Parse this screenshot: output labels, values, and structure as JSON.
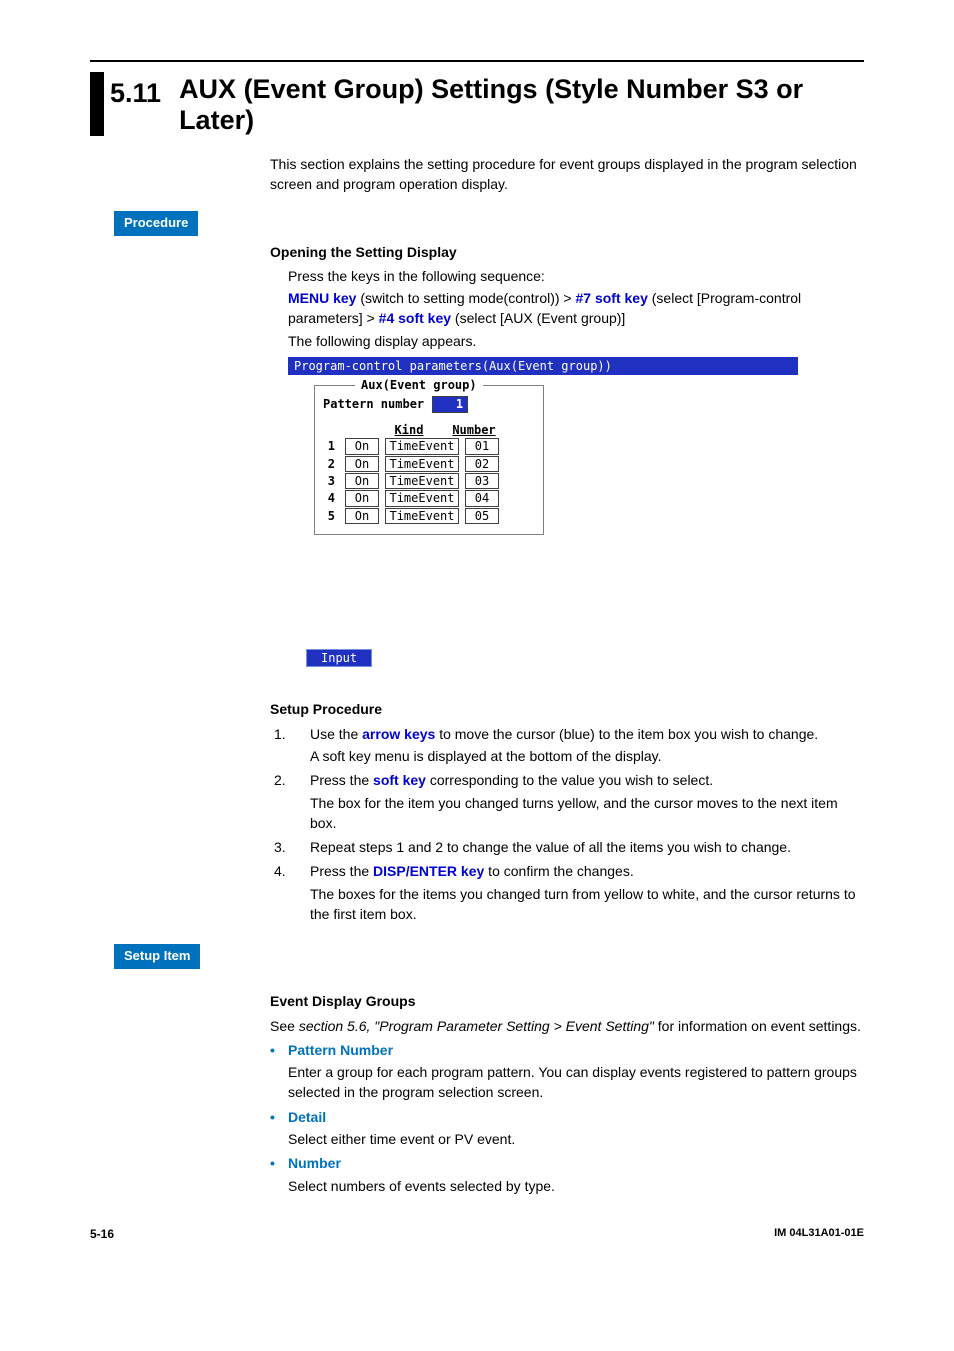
{
  "section": {
    "number": "5.11",
    "title": "AUX (Event Group) Settings (Style Number S3 or Later)"
  },
  "intro": "This section explains the setting procedure for event groups displayed in the program selection screen and program operation display.",
  "tags": {
    "procedure": "Procedure",
    "setup_item": "Setup Item"
  },
  "opening": {
    "heading": "Opening the Setting Display",
    "press": "Press the keys in the following sequence:",
    "seq": {
      "menu_key": "MENU key",
      "t1": " (switch to setting mode(control)) > ",
      "soft7": "#7 soft key",
      "t2": " (select [Program-control parameters] > ",
      "soft4": "#4 soft key",
      "t3": " (select [AUX (Event group)]"
    },
    "following": "The following display appears."
  },
  "screen": {
    "titlebar": "Program-control parameters(Aux(Event group))",
    "group_title": "Aux(Event group)",
    "pattern_label": "Pattern number",
    "pattern_value": "1",
    "head_kind": "Kind",
    "head_number": "Number",
    "rows": [
      {
        "idx": "1",
        "on": "On",
        "kind": "TimeEvent",
        "num": "01"
      },
      {
        "idx": "2",
        "on": "On",
        "kind": "TimeEvent",
        "num": "02"
      },
      {
        "idx": "3",
        "on": "On",
        "kind": "TimeEvent",
        "num": "03"
      },
      {
        "idx": "4",
        "on": "On",
        "kind": "TimeEvent",
        "num": "04"
      },
      {
        "idx": "5",
        "on": "On",
        "kind": "TimeEvent",
        "num": "05"
      }
    ],
    "softkey_input": "Input"
  },
  "setup_procedure": {
    "heading": "Setup Procedure",
    "steps": [
      {
        "n": "1.",
        "pre": "Use the ",
        "key": "arrow keys",
        "post": " to move the cursor (blue) to the item box you wish to change.",
        "extra": "A soft key menu is displayed at the bottom of the display."
      },
      {
        "n": "2.",
        "pre": "Press the ",
        "key": "soft key",
        "post": " corresponding to the value you wish to select.",
        "extra": "The box for the item you changed turns yellow, and the cursor moves to the next item box."
      },
      {
        "n": "3.",
        "pre": "",
        "key": "",
        "post": "Repeat steps 1 and 2 to change the value of all the items you wish to change.",
        "extra": ""
      },
      {
        "n": "4.",
        "pre": "Press the ",
        "key": "DISP/ENTER key",
        "post": " to confirm the changes.",
        "extra": "The boxes for the items you changed turn from yellow to white, and the cursor returns to the first item box."
      }
    ]
  },
  "event_groups": {
    "heading": "Event Display Groups",
    "see_pre": "See ",
    "see_italic": "section 5.6, \"Program Parameter Setting > Event Setting\"",
    "see_post": " for information on event settings.",
    "items": [
      {
        "title": "Pattern Number",
        "desc": "Enter a group for each program pattern. You can display events registered to pattern groups selected in the program selection screen."
      },
      {
        "title": "Detail",
        "desc": "Select either time event or PV event."
      },
      {
        "title": "Number",
        "desc": "Select numbers of events selected by type."
      }
    ]
  },
  "footer": {
    "page": "5-16",
    "doc": "IM 04L31A01-01E"
  }
}
